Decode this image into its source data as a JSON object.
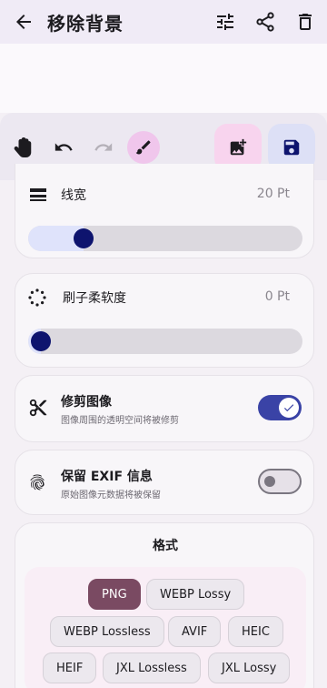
{
  "app": {
    "title": "移除背景"
  },
  "header": {
    "icons": [
      "back-arrow-icon",
      "tune-icon",
      "share-icon",
      "delete-icon"
    ]
  },
  "toolbar": {
    "tools": [
      "hand-icon",
      "undo-icon",
      "redo-icon",
      "brush-icon"
    ],
    "actions": [
      "add-image-icon",
      "save-icon"
    ]
  },
  "line_width": {
    "label": "线宽",
    "value": "20 Pt",
    "slider_fraction": 0.17
  },
  "brush_softness": {
    "label": "刷子柔软度",
    "value": "0 Pt",
    "slider_fraction": 0.0
  },
  "trim_image": {
    "label": "修剪图像",
    "description": "图像周围的透明空间将被修剪",
    "enabled": true
  },
  "keep_exif": {
    "label": "保留 EXIF 信息",
    "description": "原始图像元数据将被保留",
    "enabled": false
  },
  "format": {
    "title": "格式",
    "selected": "PNG",
    "options": [
      "PNG",
      "WEBP Lossy",
      "WEBP Lossless",
      "AVIF",
      "HEIC",
      "HEIF",
      "JXL Lossless",
      "JXL Lossy"
    ]
  },
  "colors": {
    "accent": "#3a43a6",
    "thumb": "#0e146e",
    "selected_chip": "#7a4a62"
  }
}
